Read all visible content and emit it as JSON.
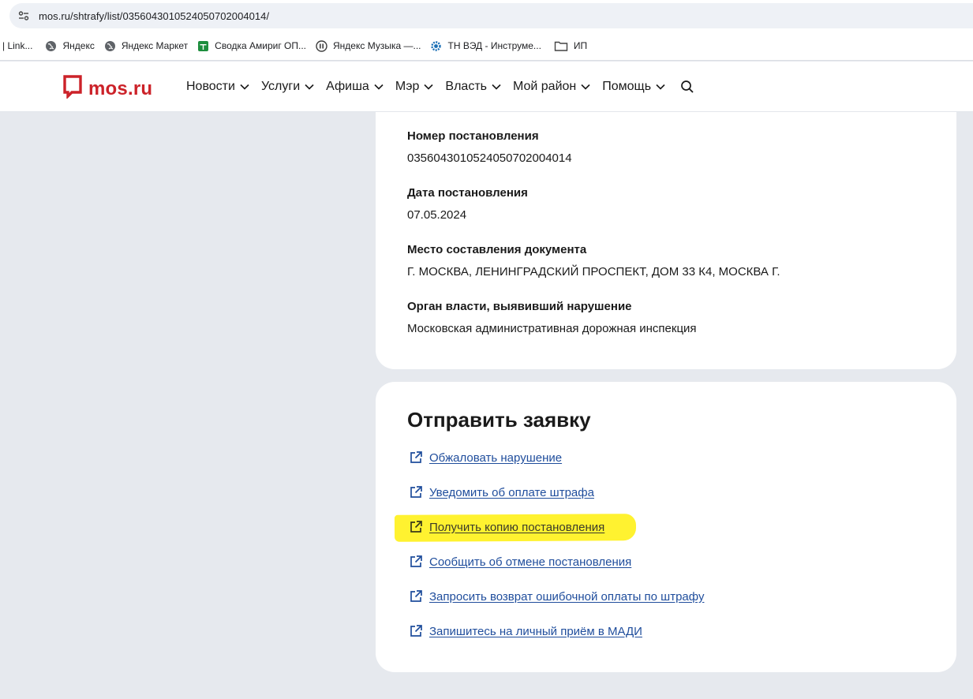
{
  "browser": {
    "url": "mos.ru/shtrafy/list/0356043010524050702004014/",
    "bookmarks": [
      {
        "label": "| Link...",
        "icon": "none"
      },
      {
        "label": "Яндекс",
        "icon": "globe-icon"
      },
      {
        "label": "Яндекс Маркет",
        "icon": "globe-icon"
      },
      {
        "label": "Сводка Амириг ОП...",
        "icon": "sheets-icon"
      },
      {
        "label": "Яндекс Музыка —...",
        "icon": "pause-icon"
      },
      {
        "label": "ТН ВЭД - Инструме...",
        "icon": "gear-icon"
      },
      {
        "label": "ИП",
        "icon": "folder-icon"
      }
    ]
  },
  "site": {
    "logo": "mos.ru",
    "nav": [
      "Новости",
      "Услуги",
      "Афиша",
      "Мэр",
      "Власть",
      "Мой район",
      "Помощь"
    ]
  },
  "details": {
    "fields": [
      {
        "label": "Номер постановления",
        "value": "0356043010524050702004014"
      },
      {
        "label": "Дата постановления",
        "value": "07.05.2024"
      },
      {
        "label": "Место составления документа",
        "value": "Г. МОСКВА, ЛЕНИНГРАДСКИЙ ПРОСПЕКТ, ДОМ 33 К4, МОСКВА Г."
      },
      {
        "label": "Орган власти, выявивший нарушение",
        "value": "Московская административная дорожная инспекция"
      }
    ]
  },
  "actions": {
    "title": "Отправить заявку",
    "links": [
      "Обжаловать нарушение",
      "Уведомить об оплате штрафа",
      "Получить копию постановления",
      "Сообщить об отмене постановления",
      "Запросить возврат ошибочной оплаты по штрафу",
      "Запишитесь на личный приём в МАДИ"
    ],
    "highlighted_index": 2
  },
  "colors": {
    "brand": "#cc2229",
    "link": "#1f4d9c",
    "highlight": "#fff230",
    "page_bg": "#e6e9ee"
  }
}
